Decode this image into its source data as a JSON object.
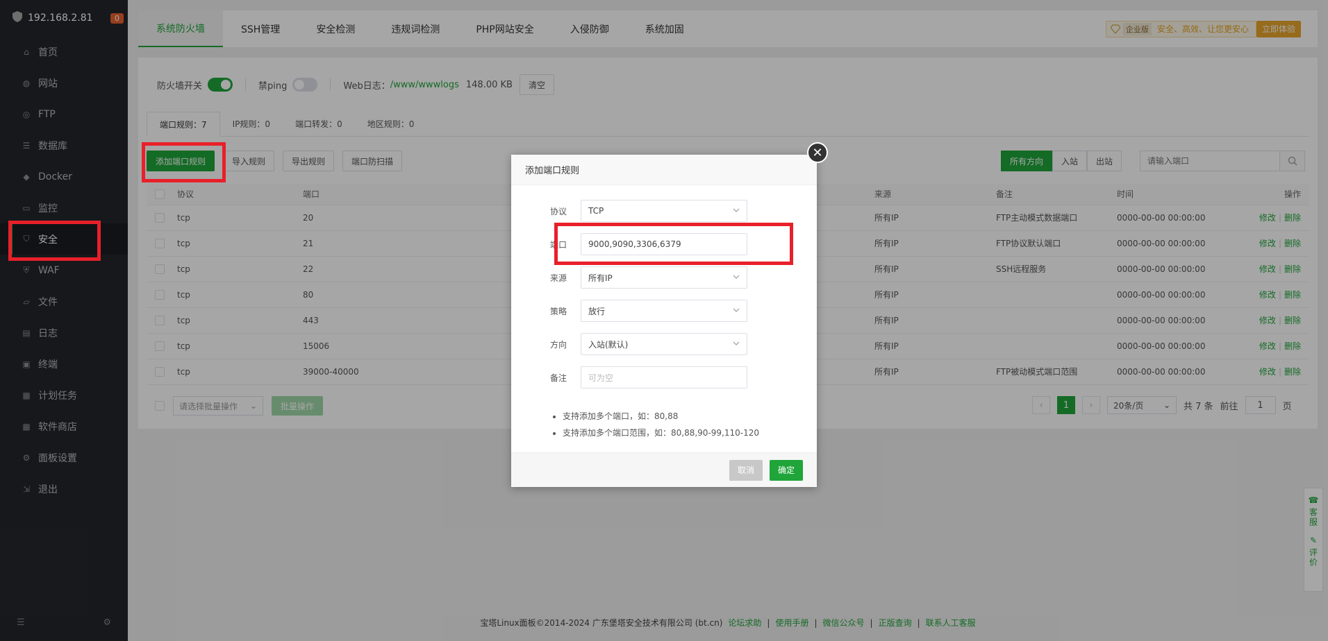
{
  "sidebar": {
    "host": "192.168.2.81",
    "badge": "0",
    "items": [
      {
        "label": "首页",
        "icon": "home-icon"
      },
      {
        "label": "网站",
        "icon": "globe-icon"
      },
      {
        "label": "FTP",
        "icon": "ftp-icon"
      },
      {
        "label": "数据库",
        "icon": "database-icon"
      },
      {
        "label": "Docker",
        "icon": "docker-icon"
      },
      {
        "label": "监控",
        "icon": "monitor-icon"
      },
      {
        "label": "安全",
        "icon": "shield-icon"
      },
      {
        "label": "WAF",
        "icon": "waf-icon"
      },
      {
        "label": "文件",
        "icon": "folder-icon"
      },
      {
        "label": "日志",
        "icon": "log-icon"
      },
      {
        "label": "终端",
        "icon": "terminal-icon"
      },
      {
        "label": "计划任务",
        "icon": "calendar-icon"
      },
      {
        "label": "软件商店",
        "icon": "grid-icon"
      },
      {
        "label": "面板设置",
        "icon": "gear-icon"
      },
      {
        "label": "退出",
        "icon": "logout-icon"
      }
    ],
    "active_index": 6
  },
  "tabs": [
    "系统防火墙",
    "SSH管理",
    "安全检测",
    "违规词检测",
    "PHP网站安全",
    "入侵防御",
    "系统加固"
  ],
  "promo": {
    "enterprise": "企业版",
    "slogan": "安全、高效、让您更安心",
    "button": "立即体验"
  },
  "firewall": {
    "switch_label": "防火墙开关",
    "ping_label": "禁ping",
    "log_label": "Web日志：",
    "log_path": "/www/wwwlogs",
    "log_size": "148.00 KB",
    "clear_btn": "清空"
  },
  "subtabs": [
    "端口规则：7",
    "IP规则：0",
    "端口转发：0",
    "地区规则：0"
  ],
  "actions": [
    "添加端口规则",
    "导入规则",
    "导出规则",
    "端口防扫描"
  ],
  "direction": [
    "所有方向",
    "入站",
    "出站"
  ],
  "search": {
    "placeholder": "请输入端口"
  },
  "table": {
    "headers": [
      "协议",
      "端口",
      "来源",
      "备注",
      "时间",
      "操作"
    ],
    "rows": [
      {
        "proto": "tcp",
        "port": "20",
        "source": "所有IP",
        "note": "FTP主动模式数据端口",
        "time": "0000-00-00 00:00:00"
      },
      {
        "proto": "tcp",
        "port": "21",
        "source": "所有IP",
        "note": "FTP协议默认端口",
        "time": "0000-00-00 00:00:00"
      },
      {
        "proto": "tcp",
        "port": "22",
        "source": "所有IP",
        "note": "SSH远程服务",
        "time": "0000-00-00 00:00:00"
      },
      {
        "proto": "tcp",
        "port": "80",
        "source": "所有IP",
        "note": "",
        "time": "0000-00-00 00:00:00"
      },
      {
        "proto": "tcp",
        "port": "443",
        "source": "所有IP",
        "note": "",
        "time": "0000-00-00 00:00:00"
      },
      {
        "proto": "tcp",
        "port": "15006",
        "source": "所有IP",
        "note": "",
        "time": "0000-00-00 00:00:00"
      },
      {
        "proto": "tcp",
        "port": "39000-40000",
        "source": "所有IP",
        "note": "FTP被动模式端口范围",
        "time": "0000-00-00 00:00:00"
      }
    ],
    "edit": "修改",
    "delete": "删除"
  },
  "batch": {
    "select": "请选择批量操作",
    "button": "批量操作"
  },
  "pager": {
    "current": "1",
    "per_page": "20条/页",
    "total": "共 7 条",
    "goto": "前往",
    "page_input": "1",
    "page_unit": "页"
  },
  "footer": {
    "copyright": "宝塔Linux面板©2014-2024 广东堡塔安全技术有限公司 (bt.cn)",
    "links": [
      "论坛求助",
      "使用手册",
      "微信公众号",
      "正版查询",
      "联系人工客服"
    ]
  },
  "float": {
    "service": "客服",
    "review": "评价"
  },
  "dialog": {
    "title": "添加端口规则",
    "protocol_label": "协议",
    "protocol_value": "TCP",
    "port_label": "端口",
    "port_value": "9000,9090,3306,6379",
    "source_label": "来源",
    "source_value": "所有IP",
    "policy_label": "策略",
    "policy_value": "放行",
    "direction_label": "方向",
    "direction_value": "入站(默认)",
    "note_label": "备注",
    "note_placeholder": "可为空",
    "tips": [
      "支持添加多个端口，如：80,88",
      "支持添加多个端口范围，如：80,88,90-99,110-120"
    ],
    "cancel": "取消",
    "confirm": "确定"
  },
  "colors": {
    "accent": "#20a53a",
    "highlight": "#e8202a",
    "sidebar_bg": "#23262b"
  }
}
